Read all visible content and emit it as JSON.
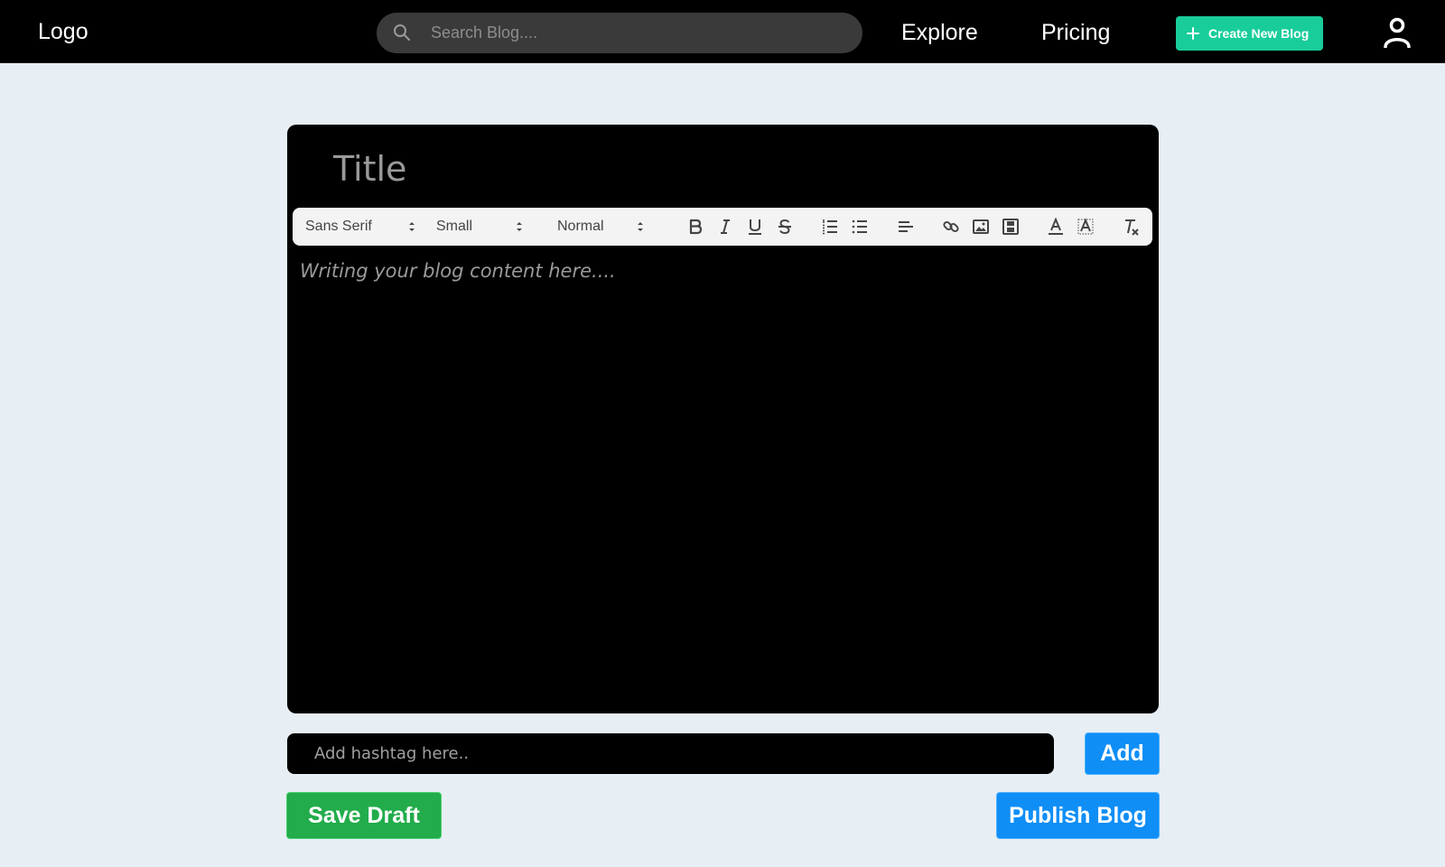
{
  "header": {
    "logo": "Logo",
    "search_placeholder": "Search Blog....",
    "nav": [
      {
        "label": "Explore"
      },
      {
        "label": "Pricing"
      }
    ],
    "create_label": "Create New Blog",
    "user_icon": "user-icon",
    "create_color": "#19cd9b"
  },
  "editor": {
    "title_placeholder": "Title",
    "toolbar": {
      "font": "Sans Serif",
      "size": "Small",
      "header": "Normal",
      "buttons": [
        "bold",
        "italic",
        "underline",
        "strike",
        "ordered-list",
        "bullet-list",
        "align",
        "link",
        "image",
        "video",
        "text-color",
        "background-color",
        "clean-format"
      ]
    },
    "content_placeholder": "Writing your blog content here...."
  },
  "hashtag": {
    "placeholder": "Add hashtag here..",
    "add_label": "Add"
  },
  "actions": {
    "save_label": "Save Draft",
    "publish_label": "Publish Blog",
    "save_color": "#22ac4b",
    "publish_color": "#0f8ef6"
  }
}
